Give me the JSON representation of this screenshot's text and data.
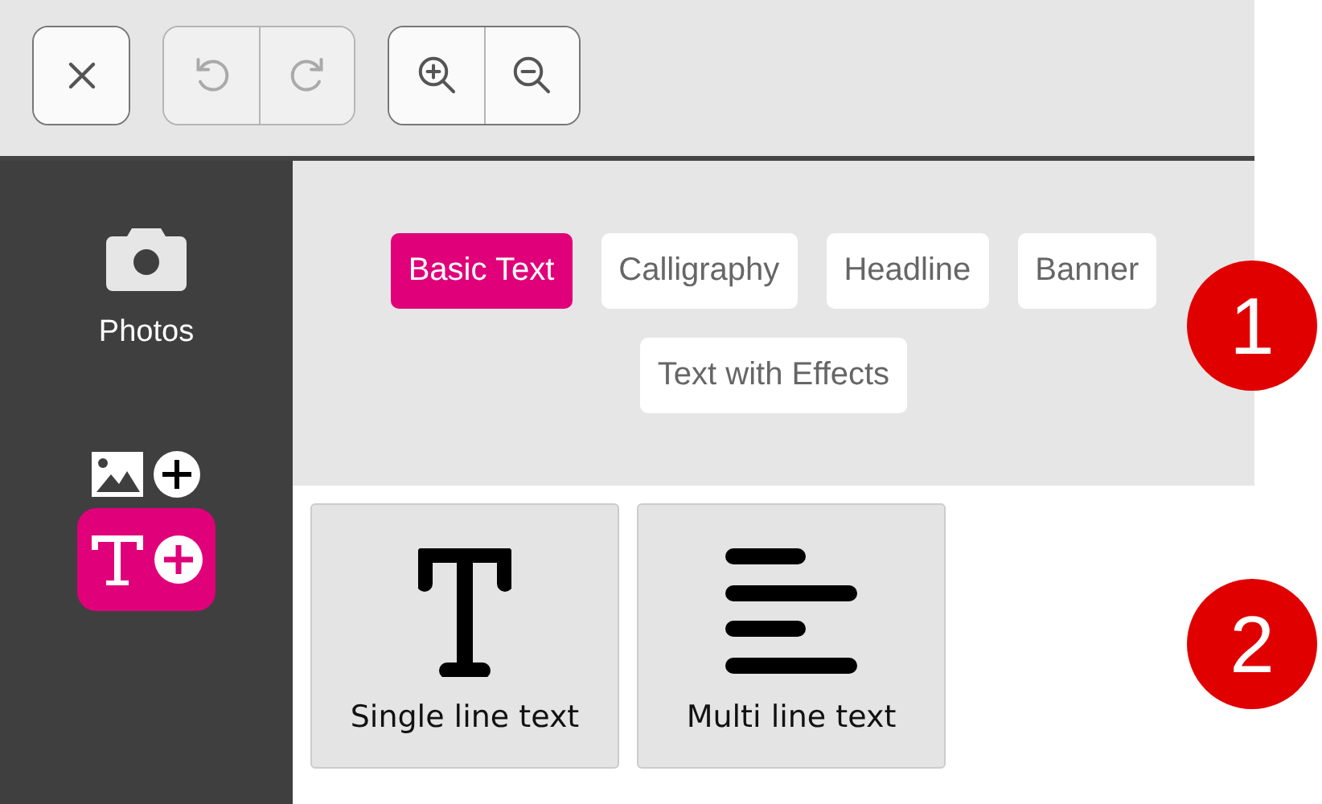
{
  "toolbar": {
    "groups": [
      {
        "buttons": [
          {
            "kind": "close",
            "disabled": false
          }
        ]
      },
      {
        "buttons": [
          {
            "kind": "undo",
            "disabled": true
          },
          {
            "kind": "redo",
            "disabled": true
          }
        ]
      },
      {
        "buttons": [
          {
            "kind": "zoom-in",
            "disabled": false
          },
          {
            "kind": "zoom-out",
            "disabled": false
          }
        ]
      }
    ]
  },
  "sidebar": {
    "items": [
      {
        "kind": "photos",
        "label": "Photos",
        "selected": false
      },
      {
        "kind": "add-image",
        "selected": false
      },
      {
        "kind": "add-text",
        "selected": true
      }
    ]
  },
  "categories": [
    {
      "label": "Basic Text",
      "selected": true
    },
    {
      "label": "Calligraphy",
      "selected": false
    },
    {
      "label": "Headline",
      "selected": false
    },
    {
      "label": "Banner",
      "selected": false
    },
    {
      "label": "Text with Effects",
      "selected": false
    }
  ],
  "text_types": [
    {
      "kind": "single",
      "label": "Single line text"
    },
    {
      "kind": "multi",
      "label": "Multi line text"
    }
  ],
  "markers": [
    "1",
    "2"
  ]
}
